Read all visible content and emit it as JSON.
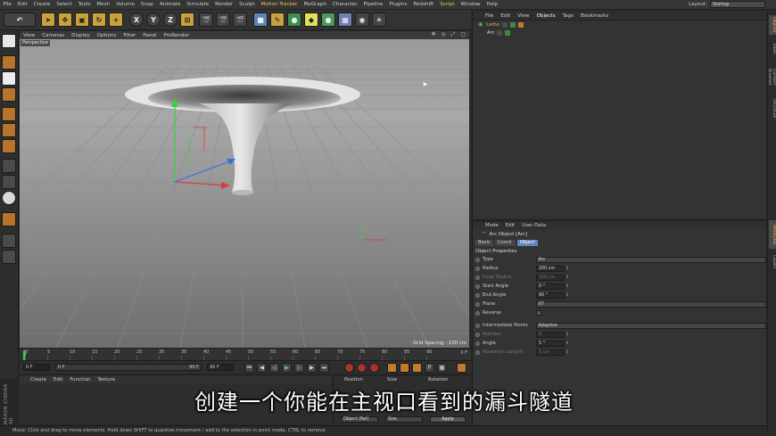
{
  "menubar": {
    "items": [
      "File",
      "Edit",
      "Create",
      "Select",
      "Tools",
      "Mesh",
      "Volume",
      "Snap",
      "Animate",
      "Simulate",
      "Render",
      "Sculpt",
      "Motion Tracker",
      "MoGraph",
      "Character",
      "Pipeline",
      "Plugins",
      "Redshift",
      "Script",
      "Window",
      "Help"
    ],
    "layout_label": "Layout:",
    "layout_value": "Startup"
  },
  "toolbar": {
    "x_axis": "X",
    "y_axis": "Y",
    "z_axis": "Z"
  },
  "viewport": {
    "menu": [
      "View",
      "Cameras",
      "Display",
      "Options",
      "Filter",
      "Panel",
      "ProRender"
    ],
    "label": "Perspective",
    "grid_spacing": "Grid Spacing : 100 cm"
  },
  "objects": {
    "menu": [
      "File",
      "Edit",
      "View",
      "Objects",
      "Tags",
      "Bookmarks"
    ],
    "active_menu": "Objects",
    "items": [
      {
        "name": "Lathe"
      },
      {
        "name": "Arc"
      }
    ]
  },
  "side_tabs": [
    "Objects",
    "Takes",
    "Content Browser",
    "Structure",
    "Attributes",
    "Layers"
  ],
  "attributes": {
    "menu": [
      "Mode",
      "Edit",
      "User Data"
    ],
    "object_name": "Arc Object [Arc]",
    "tabs": [
      "Basic",
      "Coord.",
      "Object"
    ],
    "active_tab": "Object",
    "section": "Object Properties",
    "props": [
      {
        "label": "Type",
        "value": "Arc",
        "kind": "wide",
        "dim": false
      },
      {
        "label": "Radius",
        "value": "200 cm",
        "kind": "num",
        "dim": false
      },
      {
        "label": "Inner Radius",
        "value": "100 cm",
        "kind": "num",
        "dim": true
      },
      {
        "label": "Start Angle",
        "value": "0 °",
        "kind": "num",
        "dim": false
      },
      {
        "label": "End Angle",
        "value": "90 °",
        "kind": "num",
        "dim": false
      },
      {
        "label": "Plane",
        "value": "XY",
        "kind": "wide",
        "dim": false
      },
      {
        "label": "Reverse",
        "value": "",
        "kind": "check",
        "dim": false
      },
      {
        "label": "",
        "value": "",
        "kind": "gap",
        "dim": false
      },
      {
        "label": "Intermediate Points",
        "value": "Adaptive",
        "kind": "wide",
        "dim": false
      },
      {
        "label": "Number",
        "value": "8",
        "kind": "num",
        "dim": true
      },
      {
        "label": "Angle",
        "value": "5 °",
        "kind": "num",
        "dim": false
      },
      {
        "label": "Maximum Length",
        "value": "5 cm",
        "kind": "num",
        "dim": true
      }
    ]
  },
  "timeline": {
    "ticks": [
      "0",
      "5",
      "10",
      "15",
      "20",
      "25",
      "30",
      "35",
      "40",
      "45",
      "50",
      "55",
      "60",
      "65",
      "70",
      "75",
      "80",
      "85",
      "90"
    ],
    "end_label": "0 F"
  },
  "transport": {
    "start": "0 F",
    "cur": "0 F",
    "range_end": "90 F",
    "end": "90 F"
  },
  "materials": {
    "menu": [
      "Create",
      "Edit",
      "Function",
      "Texture"
    ]
  },
  "coords": {
    "headers": [
      "Position",
      "Size",
      "Rotation"
    ],
    "mode": "Object (Rel)",
    "size_mode": "Size",
    "apply": "Apply"
  },
  "logo": "MAXON CINEMA 4D",
  "status": "Move: Click and drag to move elements. Hold down SHIFT to quantize movement / add to the selection in point mode, CTRL to remove.",
  "subtitle": "创建一个你能在主视口看到的漏斗隧道"
}
